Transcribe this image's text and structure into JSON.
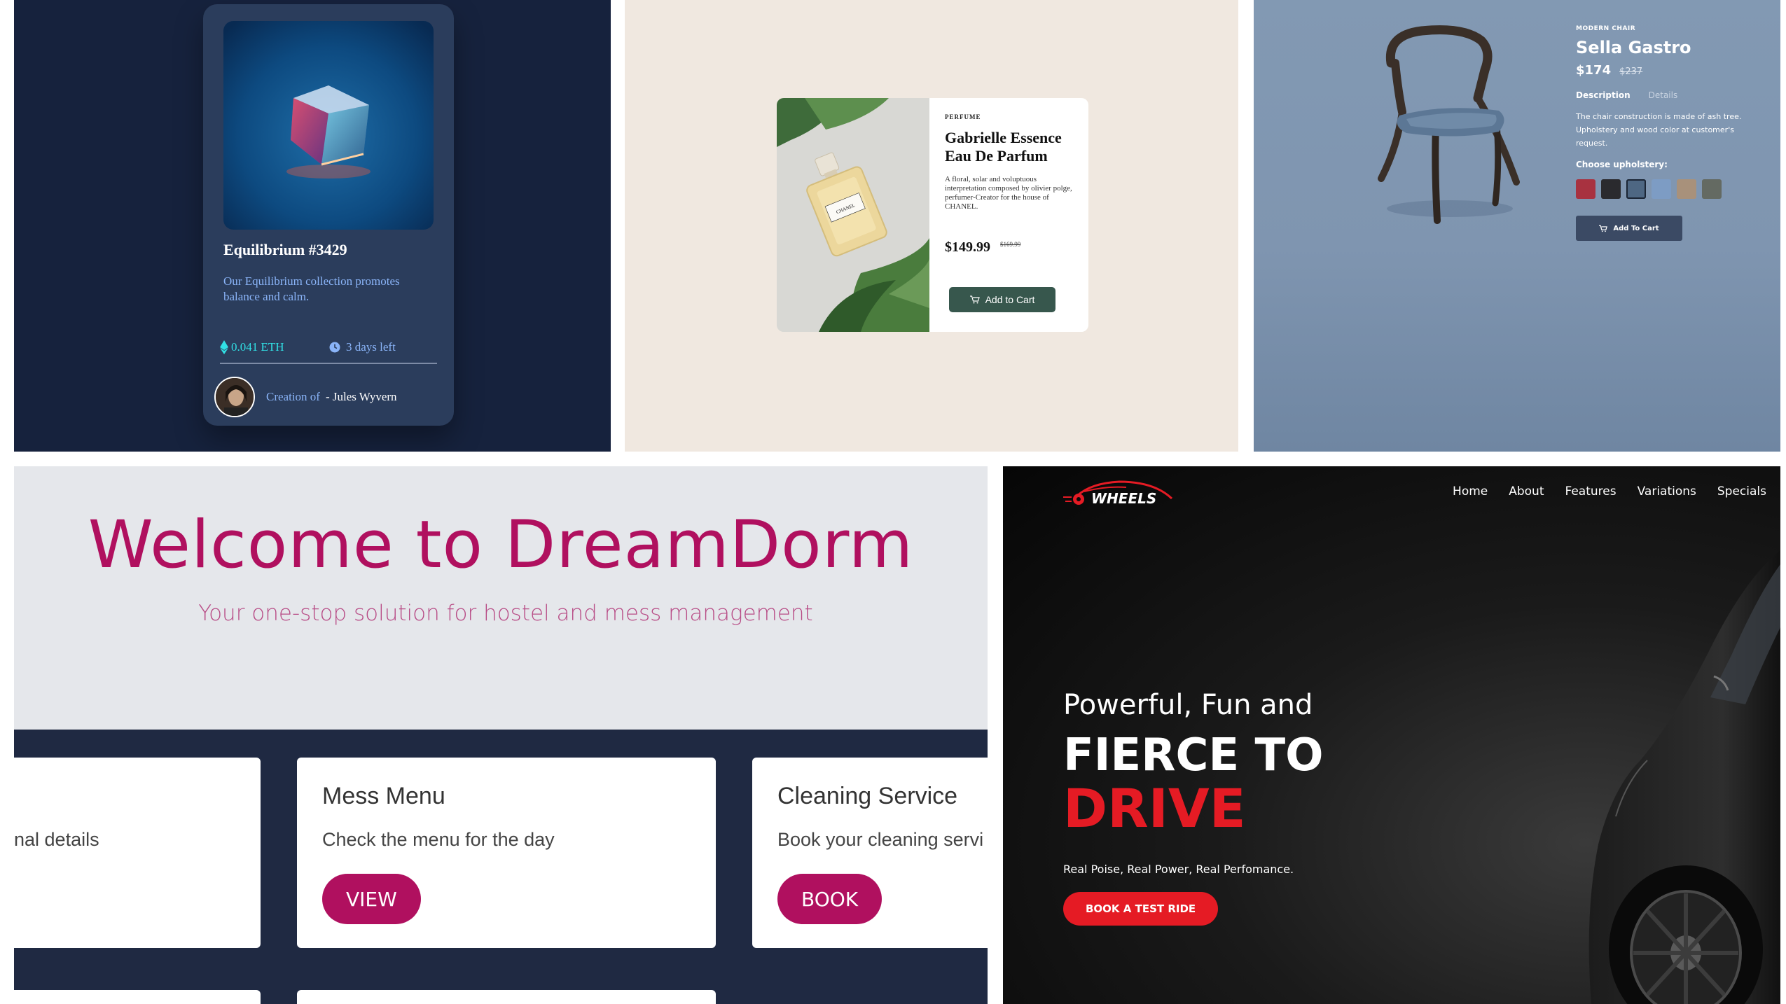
{
  "nft": {
    "title": "Equilibrium #3429",
    "description": "Our Equilibrium collection promotes balance and calm.",
    "price": "0.041 ETH",
    "time_left": "3 days left",
    "creator_prefix": "Creation of",
    "creator_name": "- Jules Wyvern"
  },
  "perfume": {
    "category": "PERFUME",
    "name": "Gabrielle Essence Eau De Parfum",
    "description": "A floral, solar and voluptuous interpretation composed by olivier polge, perfumer-Creator for the house of CHANEL.",
    "price": "$149.99",
    "old_price": "$169.99",
    "cart_label": "Add to Cart"
  },
  "chair": {
    "category": "MODERN CHAIR",
    "name": "Sella Gastro",
    "price": "$174",
    "old_price": "$237",
    "tab_description": "Description",
    "tab_details": "Details",
    "description": "The chair construction is made of ash tree. Upholstery and wood color at customer's request.",
    "choose_label": "Choose upholstery:",
    "swatches": [
      "#a83240",
      "#2a2a2e",
      "#4e6783",
      "#7d9cc4",
      "#a8917b",
      "#646a62"
    ],
    "cart_label": "Add To Cart"
  },
  "dorm": {
    "title": "Welcome to DreamDorm",
    "subtitle": "Your one-stop solution for hostel and mess management",
    "cards": [
      {
        "title": "",
        "text": "nal details",
        "button": ""
      },
      {
        "title": "Mess Menu",
        "text": "Check the menu for the day",
        "button": "VIEW"
      },
      {
        "title": "Cleaning Service",
        "text": "Book your cleaning servi",
        "button": "BOOK"
      }
    ],
    "accent": "#b0105f"
  },
  "wheels": {
    "logo_text": "WHEELS",
    "nav": [
      "Home",
      "About",
      "Features",
      "Variations",
      "Specials"
    ],
    "heading_line1": "Powerful, Fun and",
    "heading_line2": "FIERCE TO",
    "heading_line3": "DRIVE",
    "tagline": "Real Poise, Real Power, Real Perfomance.",
    "cta": "BOOK A TEST RIDE",
    "accent": "#e51b24"
  }
}
